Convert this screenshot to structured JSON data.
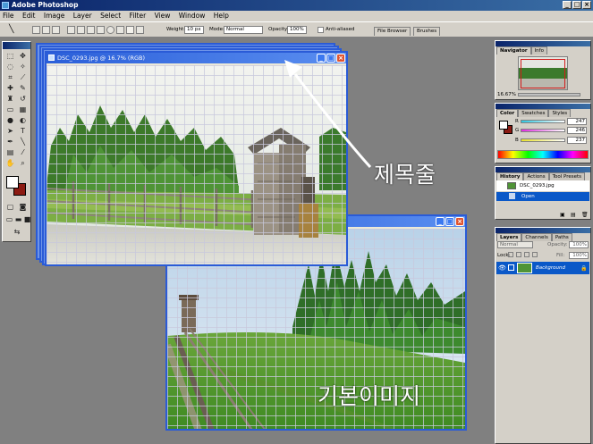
{
  "app": {
    "title": "Adobe Photoshop"
  },
  "menu": [
    "File",
    "Edit",
    "Image",
    "Layer",
    "Select",
    "Filter",
    "View",
    "Window",
    "Help"
  ],
  "options": {
    "weight_label": "Weight:",
    "weight_value": "10 px",
    "mode_label": "Mode:",
    "mode_value": "Normal",
    "opacity_label": "Opacity:",
    "opacity_value": "100%",
    "antialiased_label": "Anti-aliased",
    "tab_file_browser": "File Browser",
    "tab_brushes": "Brushes"
  },
  "document": {
    "title": "DSC_0293.jpg @ 16.7% (RGB)"
  },
  "navigator": {
    "tabs": [
      "Navigator",
      "Info"
    ],
    "zoom": "16.67%"
  },
  "color_panel": {
    "tabs": [
      "Color",
      "Swatches",
      "Styles"
    ],
    "channels": [
      {
        "label": "R",
        "value": "247"
      },
      {
        "label": "G",
        "value": "246"
      },
      {
        "label": "B",
        "value": "237"
      }
    ]
  },
  "history": {
    "tabs": [
      "History",
      "Actions",
      "Tool Presets"
    ],
    "snapshot": "DSC_0293.jpg",
    "step": "Open"
  },
  "layers": {
    "tabs": [
      "Layers",
      "Channels",
      "Paths"
    ],
    "mode": "Normal",
    "opacity_label": "Opacity:",
    "opacity_value": "100%",
    "lock_label": "Lock:",
    "fill_label": "Fill:",
    "fill_value": "100%",
    "layer_name": "Background"
  },
  "annotations": {
    "title_bar_label": "제목줄",
    "base_image_label": "기본이미지"
  },
  "colors": {
    "title_blue": "#0a246a",
    "doc_blue": "#2a5bd7",
    "workspace": "#808080",
    "foreground": "#ffffff",
    "background": "#8b1a12"
  }
}
